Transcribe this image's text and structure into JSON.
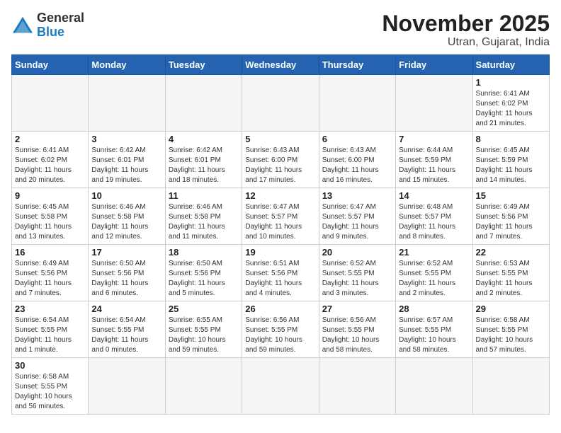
{
  "header": {
    "logo_general": "General",
    "logo_blue": "Blue",
    "month_title": "November 2025",
    "location": "Utran, Gujarat, India"
  },
  "weekdays": [
    "Sunday",
    "Monday",
    "Tuesday",
    "Wednesday",
    "Thursday",
    "Friday",
    "Saturday"
  ],
  "weeks": [
    [
      {
        "day": "",
        "info": ""
      },
      {
        "day": "",
        "info": ""
      },
      {
        "day": "",
        "info": ""
      },
      {
        "day": "",
        "info": ""
      },
      {
        "day": "",
        "info": ""
      },
      {
        "day": "",
        "info": ""
      },
      {
        "day": "1",
        "info": "Sunrise: 6:41 AM\nSunset: 6:02 PM\nDaylight: 11 hours\nand 21 minutes."
      }
    ],
    [
      {
        "day": "2",
        "info": "Sunrise: 6:41 AM\nSunset: 6:02 PM\nDaylight: 11 hours\nand 20 minutes."
      },
      {
        "day": "3",
        "info": "Sunrise: 6:42 AM\nSunset: 6:01 PM\nDaylight: 11 hours\nand 19 minutes."
      },
      {
        "day": "4",
        "info": "Sunrise: 6:42 AM\nSunset: 6:01 PM\nDaylight: 11 hours\nand 18 minutes."
      },
      {
        "day": "5",
        "info": "Sunrise: 6:43 AM\nSunset: 6:00 PM\nDaylight: 11 hours\nand 17 minutes."
      },
      {
        "day": "6",
        "info": "Sunrise: 6:43 AM\nSunset: 6:00 PM\nDaylight: 11 hours\nand 16 minutes."
      },
      {
        "day": "7",
        "info": "Sunrise: 6:44 AM\nSunset: 5:59 PM\nDaylight: 11 hours\nand 15 minutes."
      },
      {
        "day": "8",
        "info": "Sunrise: 6:45 AM\nSunset: 5:59 PM\nDaylight: 11 hours\nand 14 minutes."
      }
    ],
    [
      {
        "day": "9",
        "info": "Sunrise: 6:45 AM\nSunset: 5:58 PM\nDaylight: 11 hours\nand 13 minutes."
      },
      {
        "day": "10",
        "info": "Sunrise: 6:46 AM\nSunset: 5:58 PM\nDaylight: 11 hours\nand 12 minutes."
      },
      {
        "day": "11",
        "info": "Sunrise: 6:46 AM\nSunset: 5:58 PM\nDaylight: 11 hours\nand 11 minutes."
      },
      {
        "day": "12",
        "info": "Sunrise: 6:47 AM\nSunset: 5:57 PM\nDaylight: 11 hours\nand 10 minutes."
      },
      {
        "day": "13",
        "info": "Sunrise: 6:47 AM\nSunset: 5:57 PM\nDaylight: 11 hours\nand 9 minutes."
      },
      {
        "day": "14",
        "info": "Sunrise: 6:48 AM\nSunset: 5:57 PM\nDaylight: 11 hours\nand 8 minutes."
      },
      {
        "day": "15",
        "info": "Sunrise: 6:49 AM\nSunset: 5:56 PM\nDaylight: 11 hours\nand 7 minutes."
      }
    ],
    [
      {
        "day": "16",
        "info": "Sunrise: 6:49 AM\nSunset: 5:56 PM\nDaylight: 11 hours\nand 7 minutes."
      },
      {
        "day": "17",
        "info": "Sunrise: 6:50 AM\nSunset: 5:56 PM\nDaylight: 11 hours\nand 6 minutes."
      },
      {
        "day": "18",
        "info": "Sunrise: 6:50 AM\nSunset: 5:56 PM\nDaylight: 11 hours\nand 5 minutes."
      },
      {
        "day": "19",
        "info": "Sunrise: 6:51 AM\nSunset: 5:56 PM\nDaylight: 11 hours\nand 4 minutes."
      },
      {
        "day": "20",
        "info": "Sunrise: 6:52 AM\nSunset: 5:55 PM\nDaylight: 11 hours\nand 3 minutes."
      },
      {
        "day": "21",
        "info": "Sunrise: 6:52 AM\nSunset: 5:55 PM\nDaylight: 11 hours\nand 2 minutes."
      },
      {
        "day": "22",
        "info": "Sunrise: 6:53 AM\nSunset: 5:55 PM\nDaylight: 11 hours\nand 2 minutes."
      }
    ],
    [
      {
        "day": "23",
        "info": "Sunrise: 6:54 AM\nSunset: 5:55 PM\nDaylight: 11 hours\nand 1 minute."
      },
      {
        "day": "24",
        "info": "Sunrise: 6:54 AM\nSunset: 5:55 PM\nDaylight: 11 hours\nand 0 minutes."
      },
      {
        "day": "25",
        "info": "Sunrise: 6:55 AM\nSunset: 5:55 PM\nDaylight: 10 hours\nand 59 minutes."
      },
      {
        "day": "26",
        "info": "Sunrise: 6:56 AM\nSunset: 5:55 PM\nDaylight: 10 hours\nand 59 minutes."
      },
      {
        "day": "27",
        "info": "Sunrise: 6:56 AM\nSunset: 5:55 PM\nDaylight: 10 hours\nand 58 minutes."
      },
      {
        "day": "28",
        "info": "Sunrise: 6:57 AM\nSunset: 5:55 PM\nDaylight: 10 hours\nand 58 minutes."
      },
      {
        "day": "29",
        "info": "Sunrise: 6:58 AM\nSunset: 5:55 PM\nDaylight: 10 hours\nand 57 minutes."
      }
    ],
    [
      {
        "day": "30",
        "info": "Sunrise: 6:58 AM\nSunset: 5:55 PM\nDaylight: 10 hours\nand 56 minutes."
      },
      {
        "day": "",
        "info": ""
      },
      {
        "day": "",
        "info": ""
      },
      {
        "day": "",
        "info": ""
      },
      {
        "day": "",
        "info": ""
      },
      {
        "day": "",
        "info": ""
      },
      {
        "day": "",
        "info": ""
      }
    ]
  ]
}
